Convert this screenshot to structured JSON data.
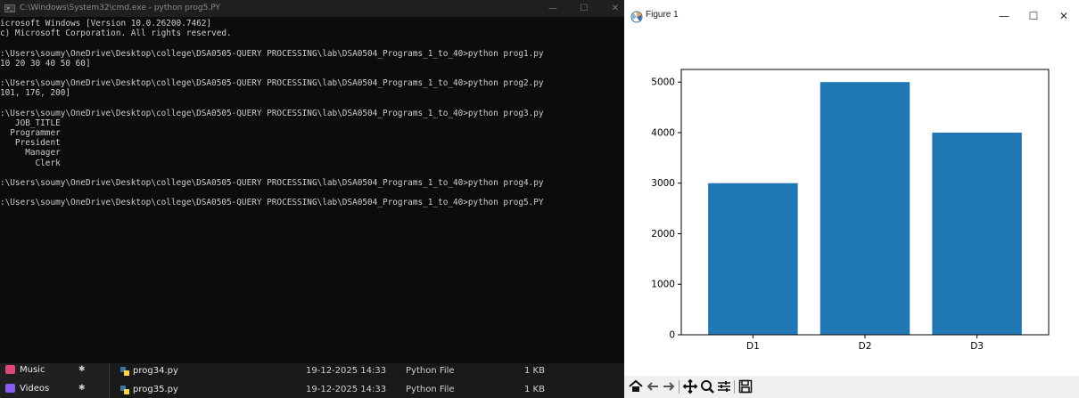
{
  "cmd": {
    "title": "C:\\Windows\\System32\\cmd.exe - python  prog5.PY",
    "lines": [
      "icrosoft Windows [Version 10.0.26200.7462]",
      "c) Microsoft Corporation. All rights reserved.",
      "",
      ":\\Users\\soumy\\OneDrive\\Desktop\\college\\DSA0505-QUERY PROCESSING\\lab\\DSA0504_Programs_1_to_40>python prog1.py",
      "10 20 30 40 50 60]",
      "",
      ":\\Users\\soumy\\OneDrive\\Desktop\\college\\DSA0505-QUERY PROCESSING\\lab\\DSA0504_Programs_1_to_40>python prog2.py",
      "101, 176, 200]",
      "",
      ":\\Users\\soumy\\OneDrive\\Desktop\\college\\DSA0505-QUERY PROCESSING\\lab\\DSA0504_Programs_1_to_40>python prog3.py",
      "   JOB_TITLE",
      "  Programmer",
      "   President",
      "     Manager",
      "       Clerk",
      "",
      ":\\Users\\soumy\\OneDrive\\Desktop\\college\\DSA0505-QUERY PROCESSING\\lab\\DSA0504_Programs_1_to_40>python prog4.py",
      "",
      ":\\Users\\soumy\\OneDrive\\Desktop\\college\\DSA0505-QUERY PROCESSING\\lab\\DSA0504_Programs_1_to_40>python prog5.PY"
    ],
    "controls": {
      "minimize": "—",
      "maximize": "☐",
      "close": "✕"
    }
  },
  "explorer": {
    "nav_items": [
      {
        "label": "Music",
        "icon": "music-icon",
        "color": "#e0457b"
      },
      {
        "label": "Videos",
        "icon": "video-icon",
        "color": "#8a5cf6"
      }
    ],
    "pin_icon": "pin-icon",
    "files": [
      {
        "name": "prog34.py",
        "date": "19-12-2025 14:33",
        "type": "Python File",
        "size": "1 KB"
      },
      {
        "name": "prog35.py",
        "date": "19-12-2025 14:33",
        "type": "Python File",
        "size": "1 KB"
      }
    ]
  },
  "figure": {
    "title": "Figure 1",
    "controls": {
      "minimize": "—",
      "maximize": "☐",
      "close": "✕"
    },
    "toolbar": [
      "home-icon",
      "back-arrow-icon",
      "forward-arrow-icon",
      "pan-icon",
      "zoom-icon",
      "configure-subplots-icon",
      "save-icon"
    ]
  },
  "chart_data": {
    "type": "bar",
    "categories": [
      "D1",
      "D2",
      "D3"
    ],
    "values": [
      3000,
      5000,
      4000
    ],
    "ylim": [
      0,
      5250
    ],
    "yticks": [
      0,
      1000,
      2000,
      3000,
      4000,
      5000
    ],
    "title": "",
    "xlabel": "",
    "ylabel": "",
    "bar_color": "#1f77b4",
    "grid": false
  }
}
